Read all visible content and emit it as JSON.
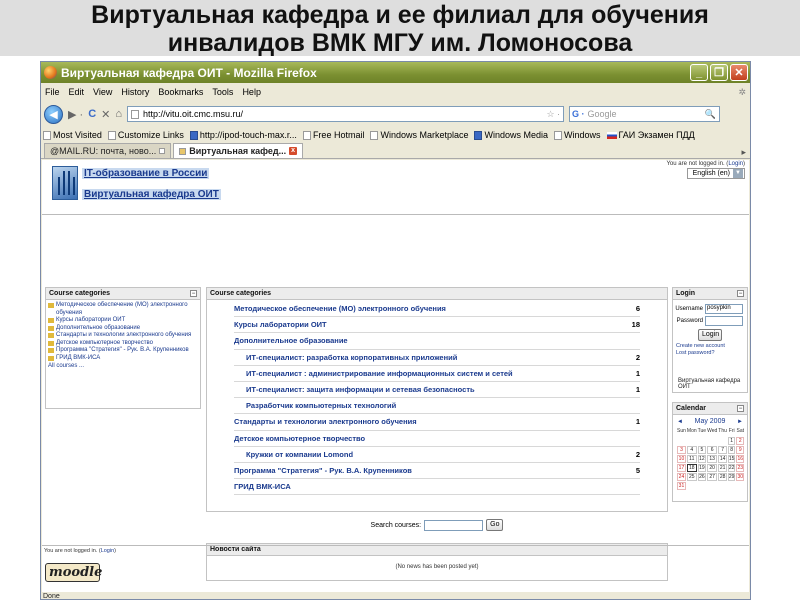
{
  "slide": {
    "title_line1": "Виртуальная кафедра и ее филиал для обучения",
    "title_line2": "инвалидов ВМК МГУ им. Ломоносова"
  },
  "window": {
    "title": "Виртуальная кафедра ОИТ - Mozilla Firefox",
    "min_glyph": "_",
    "restore_glyph": "❐",
    "close_glyph": "✕"
  },
  "menu": [
    "File",
    "Edit",
    "View",
    "History",
    "Bookmarks",
    "Tools",
    "Help"
  ],
  "nav": {
    "url": "http://vitu.oit.cmc.msu.ru/",
    "search_placeholder": "Google",
    "back_glyph": "◀",
    "forward_glyph": "▶ ·",
    "reload_glyph": "C",
    "stop_glyph": "✕",
    "home_glyph": "⌂",
    "star_glyph": "☆ ·",
    "search_engine_glyph": "G ·",
    "magnify_glyph": "🔍"
  },
  "bookmarks": [
    {
      "label": "Most Visited",
      "icon": "page"
    },
    {
      "label": "Customize Links",
      "icon": "page"
    },
    {
      "label": "http://ipod-touch-max.r...",
      "icon": "blue"
    },
    {
      "label": "Free Hotmail",
      "icon": "page"
    },
    {
      "label": "Windows Marketplace",
      "icon": "page"
    },
    {
      "label": "Windows Media",
      "icon": "blue"
    },
    {
      "label": "Windows",
      "icon": "page"
    },
    {
      "label": "ГАИ Экзамен ПДД",
      "icon": "flag"
    }
  ],
  "tabs": [
    {
      "label": "@MAIL.RU: почта, ново...",
      "active": false
    },
    {
      "label": "Виртуальная кафед...",
      "active": true
    }
  ],
  "tab_list_glyph": "▸",
  "header": {
    "link1": "IT-образование в России",
    "link2": "Виртуальная кафедра ОИТ",
    "not_logged": "You are not logged in. (",
    "login_link": "Login",
    "not_logged_end": ")",
    "language": "English (en)"
  },
  "categories_block": {
    "title": "Course categories",
    "min_glyph": "−",
    "items": [
      "Методическое обеспечение (МО) электронного обучения",
      "Курсы лаборатории ОИТ",
      "Дополнительное образование",
      "Стандарты и технологии электронного обучения",
      "Детское компьютерное творчество",
      "Программа \"Стратегия\" - Рук. В.А. Крупенников",
      "ГРИД ВМК-ИСА"
    ],
    "all_courses": "All courses ..."
  },
  "main": {
    "title": "Course categories",
    "rows": [
      {
        "name": "Методическое обеспечение (МО) электронного обучения",
        "count": "6",
        "level": 0
      },
      {
        "name": "Курсы лаборатории ОИТ",
        "count": "18",
        "level": 0
      },
      {
        "name": "Дополнительное образование",
        "count": "",
        "level": 0
      },
      {
        "name": "ИТ-специалист: разработка корпоративных приложений",
        "count": "2",
        "level": 1
      },
      {
        "name": "ИТ-специалист : администрирование информационных систем и сетей",
        "count": "1",
        "level": 1
      },
      {
        "name": "ИТ-специалист: защита информации и сетевая безопасность",
        "count": "1",
        "level": 1
      },
      {
        "name": "Разработчик компьютерных технологий",
        "count": "",
        "level": 1
      },
      {
        "name": "Стандарты и технологии электронного обучения",
        "count": "1",
        "level": 0
      },
      {
        "name": "Детское компьютерное творчество",
        "count": "",
        "level": 0
      },
      {
        "name": "Кружки от компании Lomond",
        "count": "2",
        "level": 1
      },
      {
        "name": "Программа \"Стратегия\" - Рук. В.А. Крупенников",
        "count": "5",
        "level": 0
      },
      {
        "name": "ГРИД ВМК-ИСА",
        "count": "",
        "level": 0
      }
    ],
    "search_label": "Search courses:",
    "search_button": "Go",
    "news_title": "Новости сайта",
    "news_empty": "(No news has been posted yet)"
  },
  "login_block": {
    "title": "Login",
    "min_glyph": "−",
    "username_label": "Username",
    "username_value": "posypkin",
    "password_label": "Password",
    "button": "Login",
    "create_account": "Create new account",
    "lost_password": "Lost password?",
    "info": "Виртуальная кафедра ОИТ"
  },
  "calendar": {
    "title": "Calendar",
    "min_glyph": "−",
    "month": "May 2009",
    "prev_glyph": "◄",
    "next_glyph": "►",
    "weekdays": [
      "Sun",
      "Mon",
      "Tue",
      "Wed",
      "Thu",
      "Fri",
      "Sat"
    ],
    "cells": [
      "",
      "",
      "",
      "",
      "",
      "1",
      "2",
      "3",
      "4",
      "5",
      "6",
      "7",
      "8",
      "9",
      "10",
      "11",
      "12",
      "13",
      "14",
      "15",
      "16",
      "17",
      "18",
      "19",
      "20",
      "21",
      "22",
      "23",
      "24",
      "25",
      "26",
      "27",
      "28",
      "29",
      "30",
      "31",
      "",
      "",
      "",
      "",
      "",
      ""
    ],
    "today": "18"
  },
  "footer": {
    "not_logged": "You are not logged in. (",
    "login_link": "Login",
    "not_logged_end": ")",
    "logo": "moodle"
  },
  "status": "Done"
}
